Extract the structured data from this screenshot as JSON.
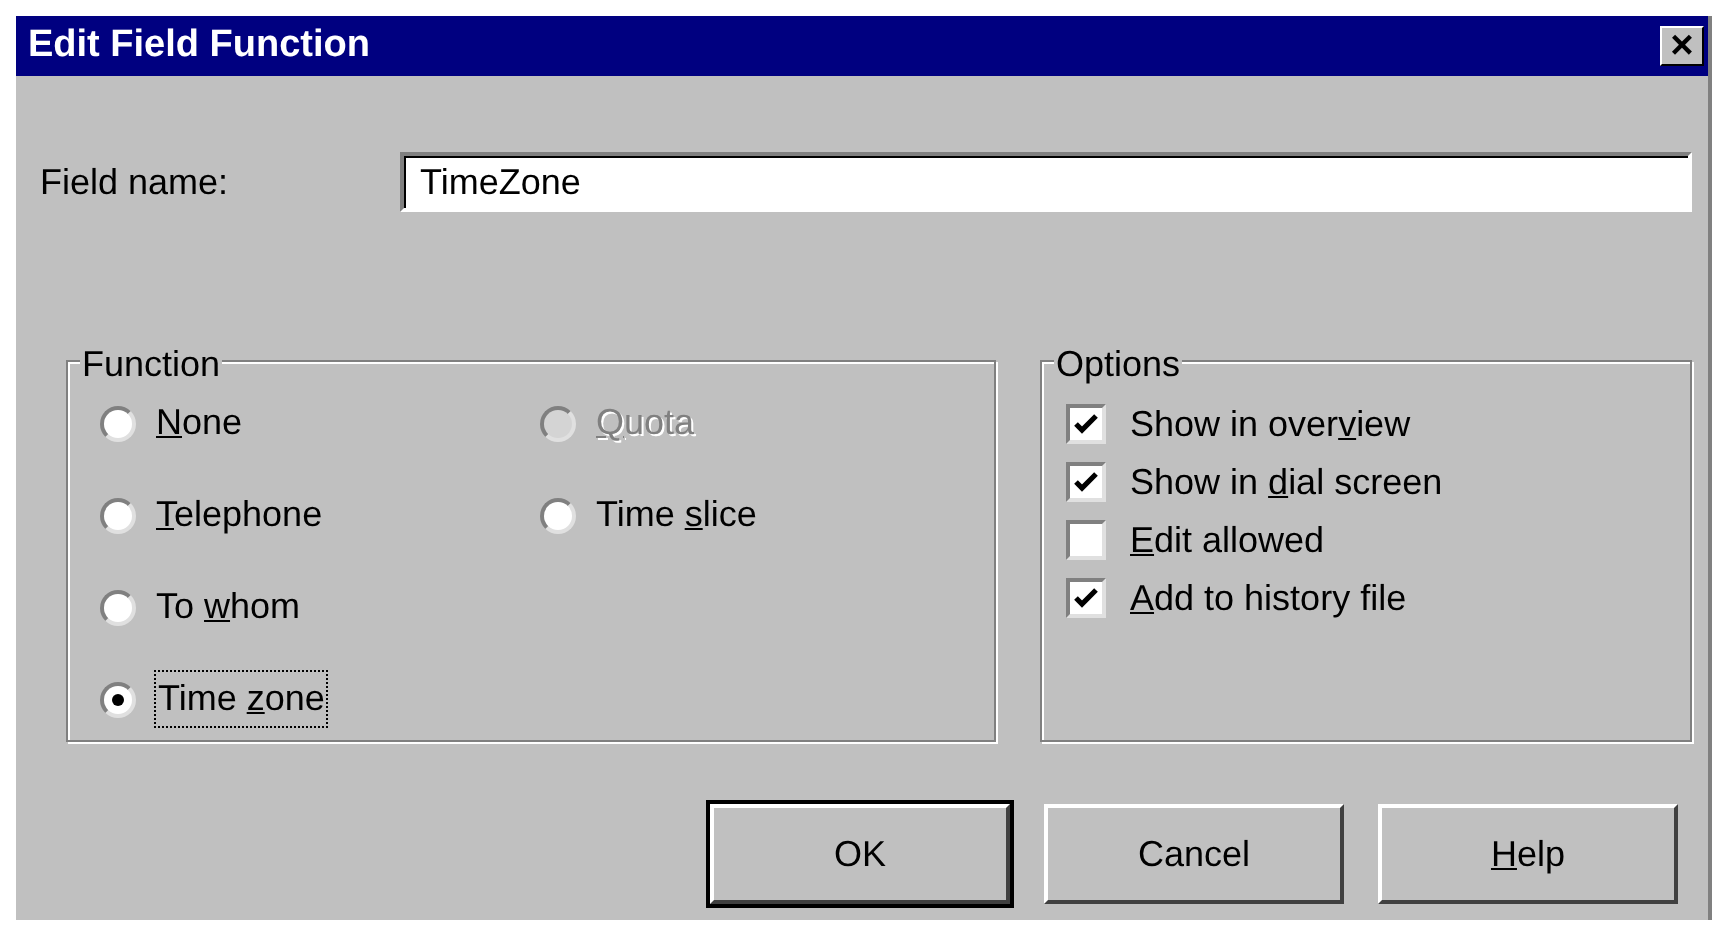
{
  "window": {
    "title": "Edit Field Function",
    "close_glyph": "×"
  },
  "field_name": {
    "label": "Field name:",
    "value": "TimeZone"
  },
  "function_group": {
    "title": "Function",
    "options": [
      {
        "label": {
          "key": "N",
          "after": "one"
        },
        "selected": false,
        "disabled": false,
        "focused": false
      },
      {
        "label": {
          "key": "T",
          "after": "elephone"
        },
        "selected": false,
        "disabled": false,
        "focused": false
      },
      {
        "label": {
          "before": "To ",
          "key": "w",
          "after": "hom"
        },
        "selected": false,
        "disabled": false,
        "focused": false
      },
      {
        "label": {
          "before": "Time ",
          "key": "z",
          "after": "one"
        },
        "selected": true,
        "disabled": false,
        "focused": true
      },
      {
        "label": {
          "key": "Q",
          "after": "uota"
        },
        "selected": false,
        "disabled": true,
        "focused": false
      },
      {
        "label": {
          "before": "Time ",
          "key": "s",
          "after": "lice"
        },
        "selected": false,
        "disabled": false,
        "focused": false
      }
    ]
  },
  "options_group": {
    "title": "Options",
    "options": [
      {
        "label": {
          "before": "Show in over",
          "key": "v",
          "after": "iew"
        },
        "checked": true
      },
      {
        "label": {
          "before": "Show in ",
          "key": "d",
          "after": "ial screen"
        },
        "checked": true
      },
      {
        "label": {
          "key": "E",
          "after": "dit allowed"
        },
        "checked": false
      },
      {
        "label": {
          "key": "A",
          "after": "dd to history file"
        },
        "checked": true
      }
    ]
  },
  "buttons": [
    {
      "label": {
        "before": "OK"
      },
      "default": true
    },
    {
      "label": {
        "before": "Cancel"
      },
      "default": false
    },
    {
      "label": {
        "key": "H",
        "after": "elp"
      },
      "default": false
    }
  ]
}
